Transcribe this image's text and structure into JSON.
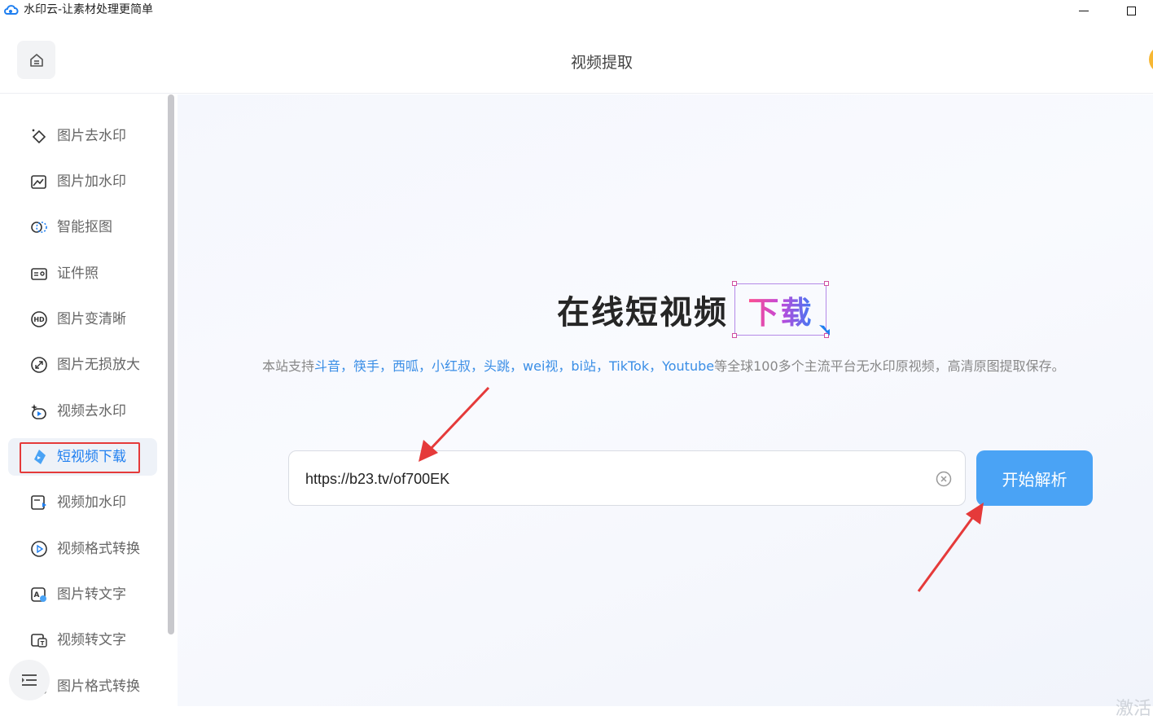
{
  "window": {
    "title": "水印云-让素材处理更简单",
    "minimize_icon": "minimize-icon",
    "maximize_icon": "maximize-icon"
  },
  "header": {
    "title": "视频提取",
    "home_icon": "home-icon"
  },
  "sidebar": {
    "items": [
      {
        "label": "图片去水印",
        "icon": "eraser-icon"
      },
      {
        "label": "图片加水印",
        "icon": "image-edit-icon"
      },
      {
        "label": "智能抠图",
        "icon": "cutout-icon"
      },
      {
        "label": "证件照",
        "icon": "id-card-icon"
      },
      {
        "label": "图片变清晰",
        "icon": "hd-icon"
      },
      {
        "label": "图片无损放大",
        "icon": "expand-icon"
      },
      {
        "label": "视频去水印",
        "icon": "video-clean-icon"
      },
      {
        "label": "短视频下载",
        "icon": "download-icon",
        "active": true
      },
      {
        "label": "视频加水印",
        "icon": "video-mark-icon"
      },
      {
        "label": "视频格式转换",
        "icon": "play-circle-icon"
      },
      {
        "label": "图片转文字",
        "icon": "image-text-icon"
      },
      {
        "label": "视频转文字",
        "icon": "video-text-icon"
      },
      {
        "label": "图片格式转换",
        "icon": "image-format-icon"
      }
    ],
    "collapse_icon": "menu-collapse-icon"
  },
  "main": {
    "hero_title": "在线短视频",
    "hero_tag": "下载",
    "desc_prefix": "本站支持",
    "platforms": "斗音，筷手，西呱，小红叔，头跳，wei视，bi站，TikTok，Youtube",
    "desc_suffix": "等全球100多个主流平台无水印原视频，高清原图提取保存。",
    "url_value": "https://b23.tv/of700EK",
    "clear_icon": "clear-circle-icon",
    "submit_label": "开始解析",
    "corner_text": "激活"
  },
  "colors": {
    "accent": "#1f7ff0",
    "button": "#4aa3f5",
    "platform_link": "#3a8ee6",
    "annotation": "#e53a3a"
  }
}
